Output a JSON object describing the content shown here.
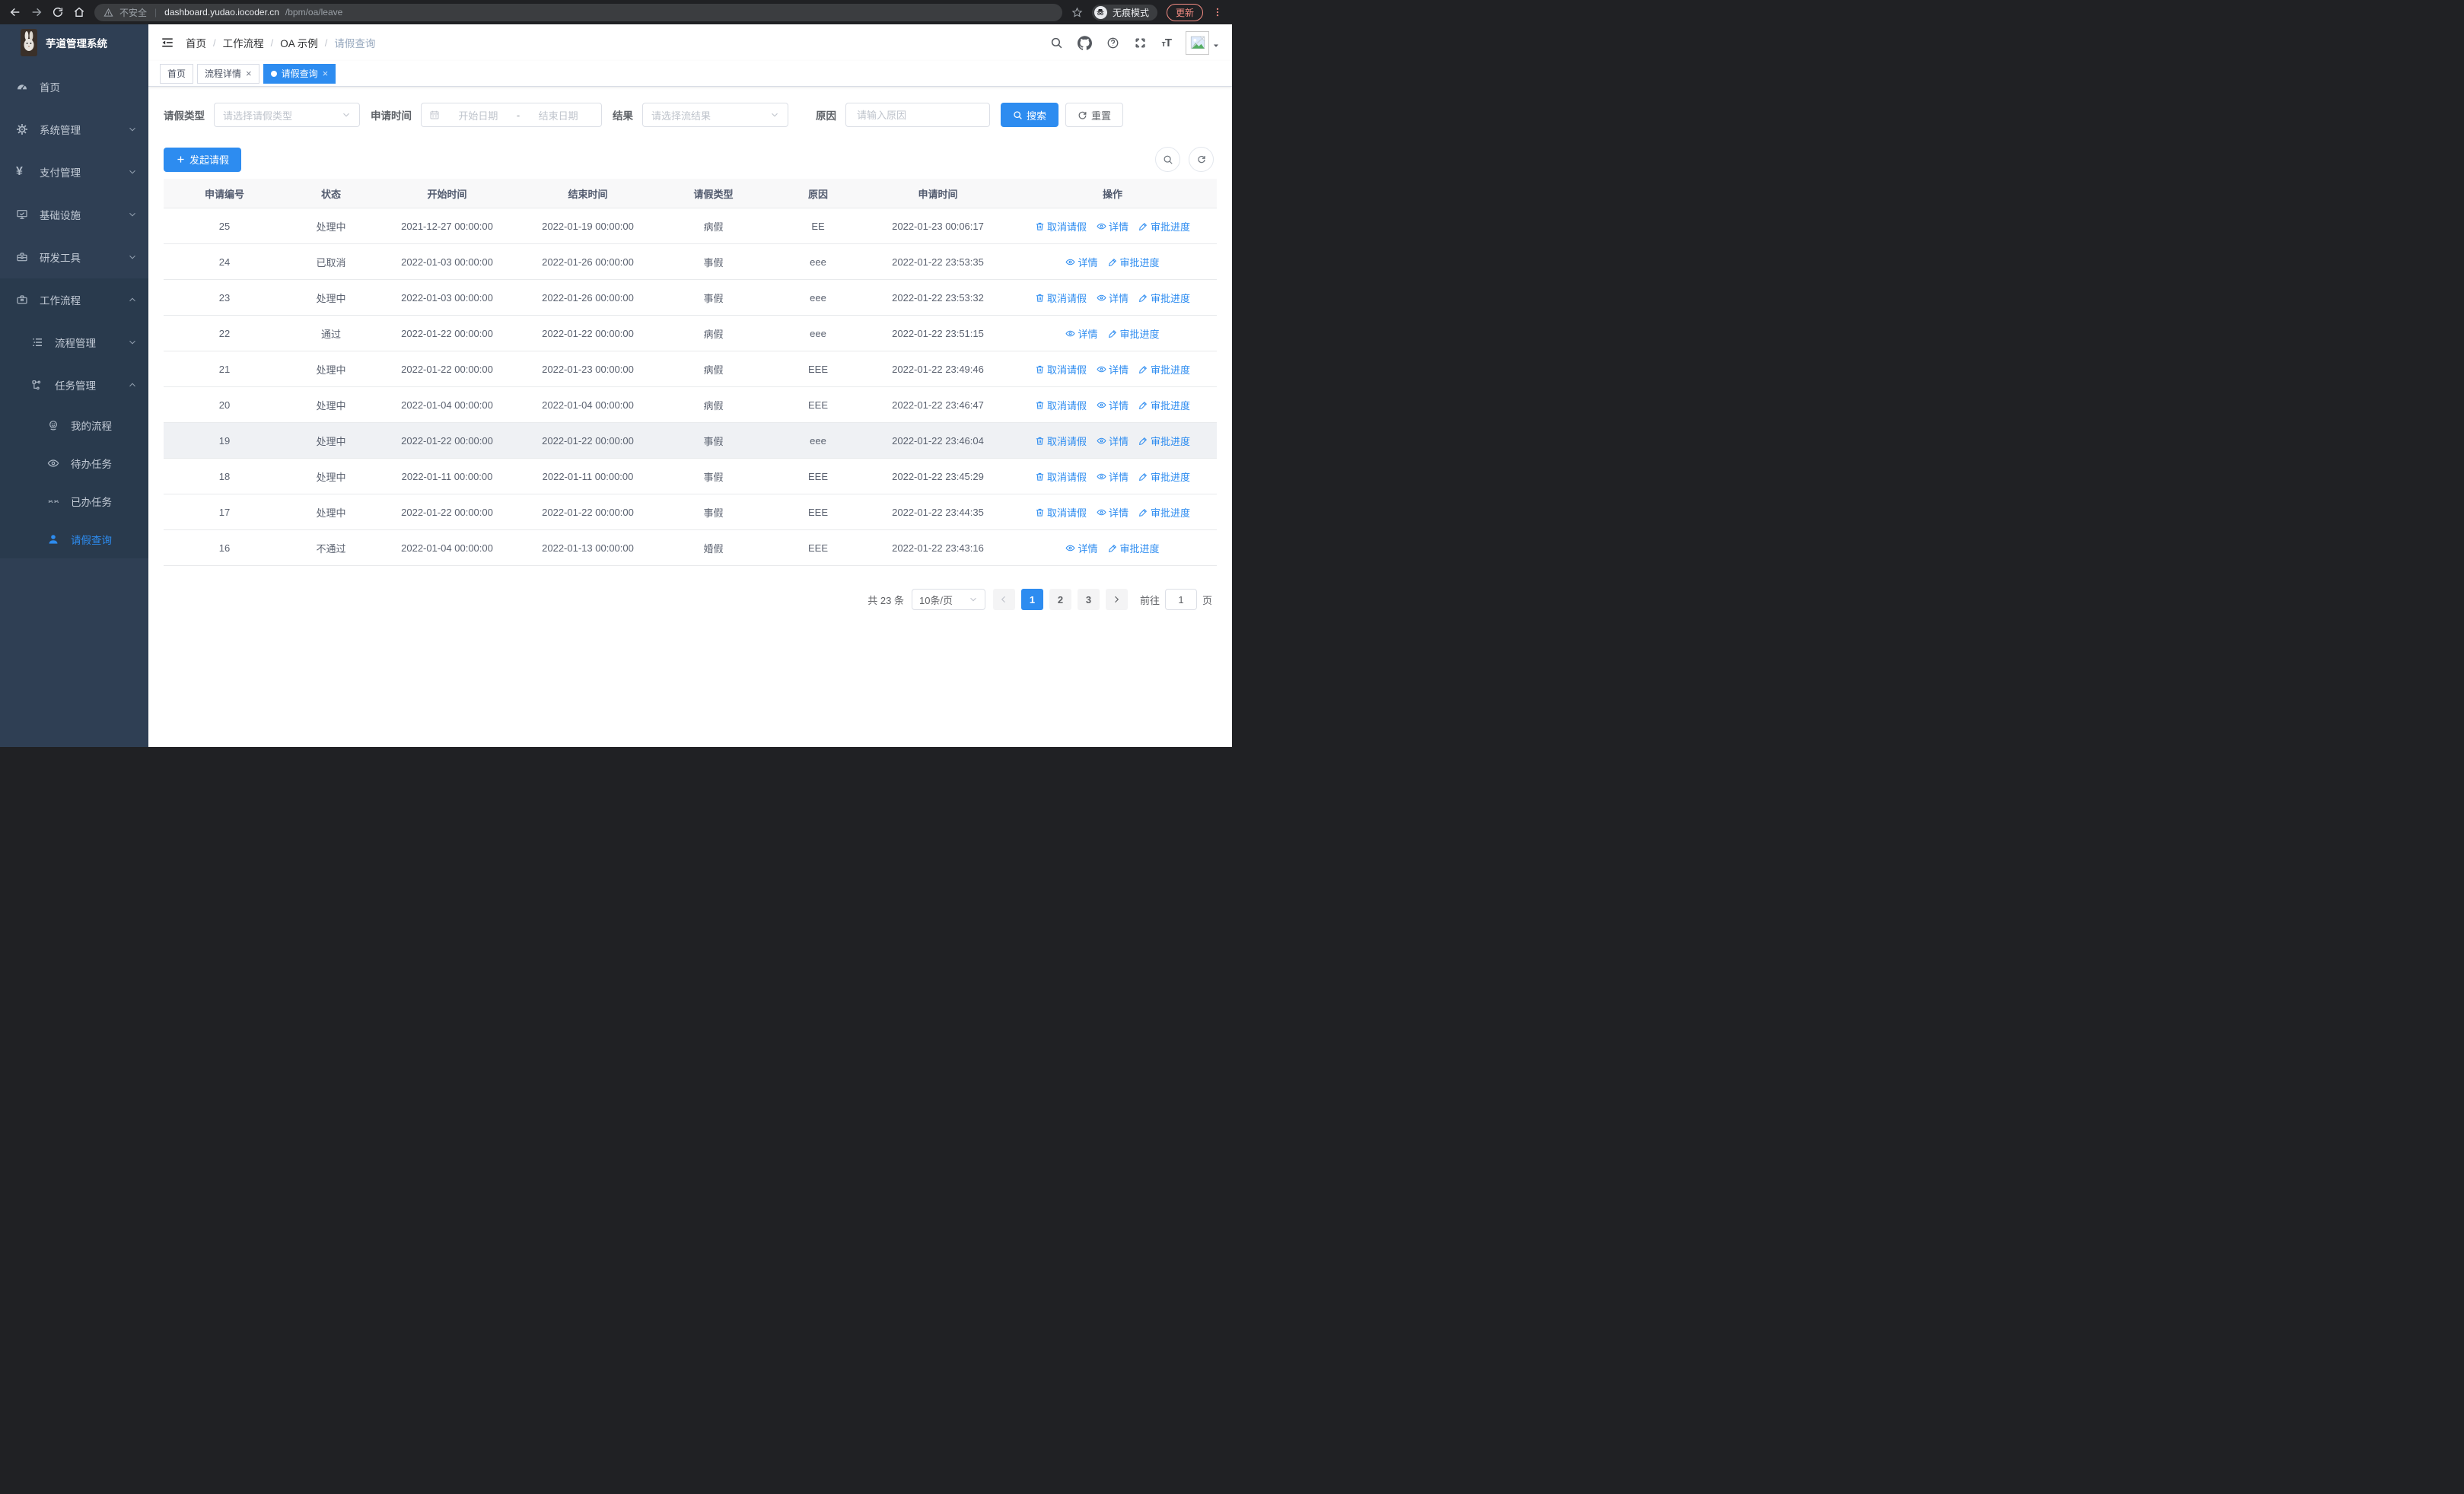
{
  "colors": {
    "accent": "#2d8cf0",
    "chrome_bar": "#202124",
    "sidebar_bg": "#2f3f54",
    "sidebar_submenu_bg": "#293a4d",
    "update_accent": "#f28b82",
    "table_header_bg": "#f8f8f9"
  },
  "browser": {
    "security_label": "不安全",
    "url_host": "dashboard.yudao.iocoder.cn",
    "url_path": "/bpm/oa/leave",
    "incognito_label": "无痕模式",
    "update_label": "更新"
  },
  "app_title": "芋道管理系统",
  "breadcrumb": {
    "items": [
      "首页",
      "工作流程",
      "OA 示例",
      "请假查询"
    ]
  },
  "tabs": [
    {
      "key": "home",
      "label": "首页",
      "closable": false,
      "active": false
    },
    {
      "key": "process-detail",
      "label": "流程详情",
      "closable": true,
      "active": false
    },
    {
      "key": "leave-query",
      "label": "请假查询",
      "closable": true,
      "active": true
    }
  ],
  "sidebar": {
    "items": [
      {
        "key": "home",
        "label": "首页",
        "icon": "gauge",
        "level": 1
      },
      {
        "key": "system",
        "label": "系统管理",
        "icon": "gear",
        "level": 1,
        "chevron": "down"
      },
      {
        "key": "payment",
        "label": "支付管理",
        "icon": "yen",
        "level": 1,
        "chevron": "down"
      },
      {
        "key": "infra",
        "label": "基础设施",
        "icon": "monitor",
        "level": 1,
        "chevron": "down"
      },
      {
        "key": "devtools",
        "label": "研发工具",
        "icon": "toolbox",
        "level": 1,
        "chevron": "down"
      },
      {
        "key": "workflow",
        "label": "工作流程",
        "icon": "briefcase",
        "level": 1,
        "chevron": "up",
        "in_expanded": true
      },
      {
        "key": "process-mgmt",
        "label": "流程管理",
        "icon": "list",
        "level": 2,
        "chevron": "down",
        "in_expanded": true
      },
      {
        "key": "task-mgmt",
        "label": "任务管理",
        "icon": "tree",
        "level": 2,
        "chevron": "up",
        "in_expanded": true
      },
      {
        "key": "my-process",
        "label": "我的流程",
        "icon": "robot",
        "level": 3,
        "in_expanded": true
      },
      {
        "key": "todo-tasks",
        "label": "待办任务",
        "icon": "eye",
        "level": 3,
        "in_expanded": true
      },
      {
        "key": "done-tasks",
        "label": "已办任务",
        "icon": "eye-closed",
        "level": 3,
        "in_expanded": true
      },
      {
        "key": "leave-query",
        "label": "请假查询",
        "icon": "person",
        "level": 3,
        "in_expanded": true,
        "active": true
      }
    ]
  },
  "filters": {
    "leave_type_label": "请假类型",
    "leave_type_placeholder": "请选择请假类型",
    "apply_time_label": "申请时间",
    "start_date_placeholder": "开始日期",
    "date_separator": "-",
    "end_date_placeholder": "结束日期",
    "result_label": "结果",
    "result_placeholder": "请选择流结果",
    "reason_label": "原因",
    "reason_placeholder": "请输入原因",
    "search_label": "搜索",
    "reset_label": "重置"
  },
  "toolbar": {
    "create_label": "发起请假"
  },
  "table": {
    "columns": [
      "申请编号",
      "状态",
      "开始时间",
      "结束时间",
      "请假类型",
      "原因",
      "申请时间",
      "操作"
    ],
    "action_labels": {
      "cancel": "取消请假",
      "detail": "详情",
      "progress": "审批进度"
    },
    "rows": [
      {
        "id": "25",
        "status": "处理中",
        "start": "2021-12-27 00:00:00",
        "end": "2022-01-19 00:00:00",
        "type": "病假",
        "reason": "EE",
        "apply_time": "2022-01-23 00:06:17",
        "actions": [
          "cancel",
          "detail",
          "progress"
        ]
      },
      {
        "id": "24",
        "status": "已取消",
        "start": "2022-01-03 00:00:00",
        "end": "2022-01-26 00:00:00",
        "type": "事假",
        "reason": "eee",
        "apply_time": "2022-01-22 23:53:35",
        "actions": [
          "detail",
          "progress"
        ]
      },
      {
        "id": "23",
        "status": "处理中",
        "start": "2022-01-03 00:00:00",
        "end": "2022-01-26 00:00:00",
        "type": "事假",
        "reason": "eee",
        "apply_time": "2022-01-22 23:53:32",
        "actions": [
          "cancel",
          "detail",
          "progress"
        ]
      },
      {
        "id": "22",
        "status": "通过",
        "start": "2022-01-22 00:00:00",
        "end": "2022-01-22 00:00:00",
        "type": "病假",
        "reason": "eee",
        "apply_time": "2022-01-22 23:51:15",
        "actions": [
          "detail",
          "progress"
        ]
      },
      {
        "id": "21",
        "status": "处理中",
        "start": "2022-01-22 00:00:00",
        "end": "2022-01-23 00:00:00",
        "type": "病假",
        "reason": "EEE",
        "apply_time": "2022-01-22 23:49:46",
        "actions": [
          "cancel",
          "detail",
          "progress"
        ]
      },
      {
        "id": "20",
        "status": "处理中",
        "start": "2022-01-04 00:00:00",
        "end": "2022-01-04 00:00:00",
        "type": "病假",
        "reason": "EEE",
        "apply_time": "2022-01-22 23:46:47",
        "actions": [
          "cancel",
          "detail",
          "progress"
        ]
      },
      {
        "id": "19",
        "status": "处理中",
        "start": "2022-01-22 00:00:00",
        "end": "2022-01-22 00:00:00",
        "type": "事假",
        "reason": "eee",
        "apply_time": "2022-01-22 23:46:04",
        "actions": [
          "cancel",
          "detail",
          "progress"
        ],
        "highlighted": true
      },
      {
        "id": "18",
        "status": "处理中",
        "start": "2022-01-11 00:00:00",
        "end": "2022-01-11 00:00:00",
        "type": "事假",
        "reason": "EEE",
        "apply_time": "2022-01-22 23:45:29",
        "actions": [
          "cancel",
          "detail",
          "progress"
        ]
      },
      {
        "id": "17",
        "status": "处理中",
        "start": "2022-01-22 00:00:00",
        "end": "2022-01-22 00:00:00",
        "type": "事假",
        "reason": "EEE",
        "apply_time": "2022-01-22 23:44:35",
        "actions": [
          "cancel",
          "detail",
          "progress"
        ]
      },
      {
        "id": "16",
        "status": "不通过",
        "start": "2022-01-04 00:00:00",
        "end": "2022-01-13 00:00:00",
        "type": "婚假",
        "reason": "EEE",
        "apply_time": "2022-01-22 23:43:16",
        "actions": [
          "detail",
          "progress"
        ]
      }
    ]
  },
  "pagination": {
    "total_label": "共 23 条",
    "page_size": "10条/页",
    "pages": [
      "1",
      "2",
      "3"
    ],
    "current": "1",
    "goto_label": "前往",
    "goto_value": "1",
    "page_unit": "页"
  }
}
